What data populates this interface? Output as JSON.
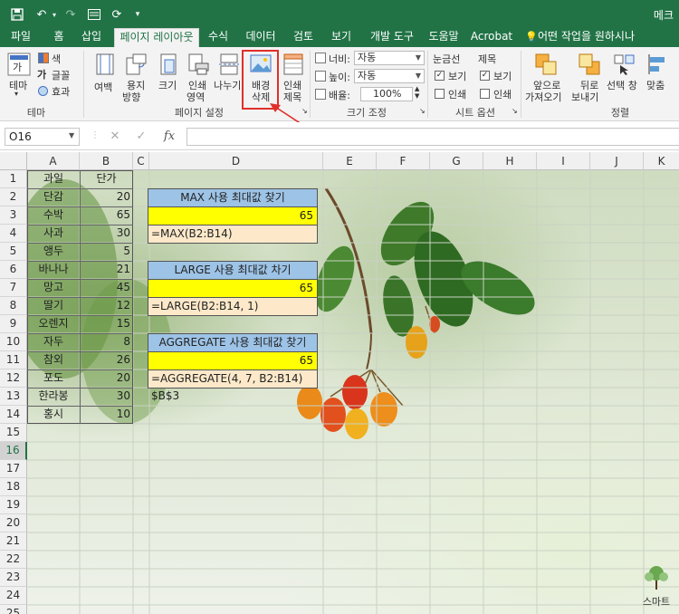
{
  "titlebar": {
    "title": "메크",
    "bg_color": "#217346"
  },
  "tabs": [
    {
      "label": "파일"
    },
    {
      "label": "홈"
    },
    {
      "label": "삽입"
    },
    {
      "label": "페이지 레이아웃",
      "active": true
    },
    {
      "label": "수식"
    },
    {
      "label": "데이터"
    },
    {
      "label": "검토"
    },
    {
      "label": "보기"
    },
    {
      "label": "개발 도구"
    },
    {
      "label": "도움말"
    },
    {
      "label": "Acrobat"
    },
    {
      "label": "어떤 작업을 원하시나요?"
    }
  ],
  "ribbon": {
    "theme": {
      "theme_label": "테마",
      "colors_label": "색",
      "fonts_label": "글꼴",
      "effects_label": "효과",
      "group": "테마"
    },
    "page_setup": {
      "margins": "여백",
      "orientation_1": "용지",
      "orientation_2": "방향",
      "size": "크기",
      "print_area_1": "인쇄",
      "print_area_2": "영역",
      "breaks": "나누기",
      "background_1": "배경",
      "background_2": "삭제",
      "print_titles_1": "인쇄",
      "print_titles_2": "제목",
      "group": "페이지 설정"
    },
    "scale": {
      "width_label": "너비:",
      "width_value": "자동",
      "height_label": "높이:",
      "height_value": "자동",
      "scale_label": "배율:",
      "scale_value": "100%",
      "group": "크기 조정"
    },
    "sheet_options": {
      "gridlines": "눈금선",
      "headings": "제목",
      "view": "보기",
      "print": "인쇄",
      "group": "시트 옵션"
    },
    "arrange": {
      "bring_forward_1": "앞으로",
      "bring_forward_2": "가져오기",
      "send_backward_1": "뒤로",
      "send_backward_2": "보내기",
      "selection_pane": "선택 창",
      "align": "맞춤",
      "group": "정렬"
    }
  },
  "formula_bar": {
    "name_box": "O16",
    "fx": "fx",
    "formula": ""
  },
  "columns": [
    "A",
    "B",
    "C",
    "D",
    "E",
    "F",
    "G",
    "H",
    "I",
    "J",
    "K"
  ],
  "rows": [
    "1",
    "2",
    "3",
    "4",
    "5",
    "6",
    "7",
    "8",
    "9",
    "10",
    "11",
    "12",
    "13",
    "14",
    "15",
    "16",
    "17",
    "18",
    "19",
    "20",
    "21",
    "22",
    "23",
    "24",
    "25"
  ],
  "selected_row": "16",
  "table": {
    "header_fruit": "과일",
    "header_price": "단가",
    "fruits": [
      "단감",
      "수박",
      "사과",
      "앵두",
      "바나나",
      "망고",
      "딸기",
      "오렌지",
      "자두",
      "참외",
      "포도",
      "한라봉",
      "홍시"
    ],
    "prices": [
      "20",
      "65",
      "30",
      "5",
      "21",
      "45",
      "12",
      "15",
      "8",
      "26",
      "20",
      "30",
      "10"
    ]
  },
  "boxes": [
    {
      "title": "MAX 사용 최대값 찾기",
      "value": "65",
      "formula": "=MAX(B2:B14)"
    },
    {
      "title": "LARGE 사용 최대값 차기",
      "value": "65",
      "formula": "=LARGE(B2:B14, 1)"
    },
    {
      "title": "AGGREGATE 사용 최대값 찾기",
      "value": "65",
      "formula": "=AGGREGATE(4, 7, B2:B14)"
    }
  ],
  "d14": "$B$3",
  "watermark": "스마트"
}
